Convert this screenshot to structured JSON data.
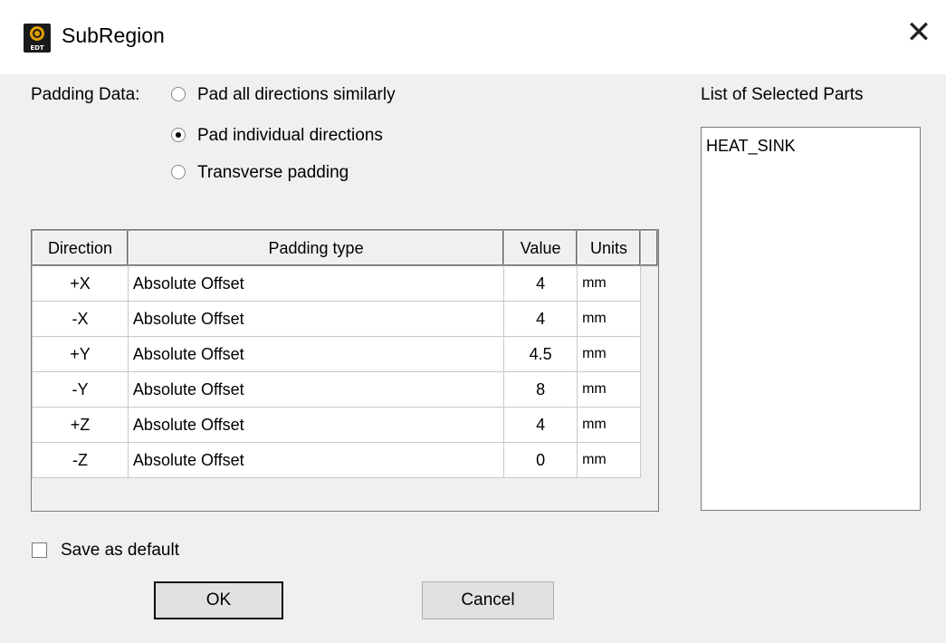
{
  "window": {
    "title": "SubRegion",
    "app_icon": "edt-app-icon",
    "close_glyph": "✕"
  },
  "padding": {
    "label": "Padding Data:",
    "options": [
      {
        "label": "Pad all directions similarly",
        "selected": false
      },
      {
        "label": "Pad individual directions",
        "selected": true
      },
      {
        "label": "Transverse padding",
        "selected": false
      }
    ]
  },
  "table": {
    "headers": [
      "Direction",
      "Padding type",
      "Value",
      "Units",
      ""
    ],
    "rows": [
      {
        "direction": "+X",
        "type": "Absolute Offset",
        "value": "4",
        "units": "mm"
      },
      {
        "direction": "-X",
        "type": "Absolute Offset",
        "value": "4",
        "units": "mm"
      },
      {
        "direction": "+Y",
        "type": "Absolute Offset",
        "value": "4.5",
        "units": "mm"
      },
      {
        "direction": "-Y",
        "type": "Absolute Offset",
        "value": "8",
        "units": "mm"
      },
      {
        "direction": "+Z",
        "type": "Absolute Offset",
        "value": "4",
        "units": "mm"
      },
      {
        "direction": "-Z",
        "type": "Absolute Offset",
        "value": "0",
        "units": "mm"
      }
    ]
  },
  "parts": {
    "label": "List of Selected Parts",
    "items": [
      "HEAT_SINK"
    ]
  },
  "save_default": {
    "label": "Save as default",
    "checked": false
  },
  "buttons": {
    "ok": "OK",
    "cancel": "Cancel"
  }
}
